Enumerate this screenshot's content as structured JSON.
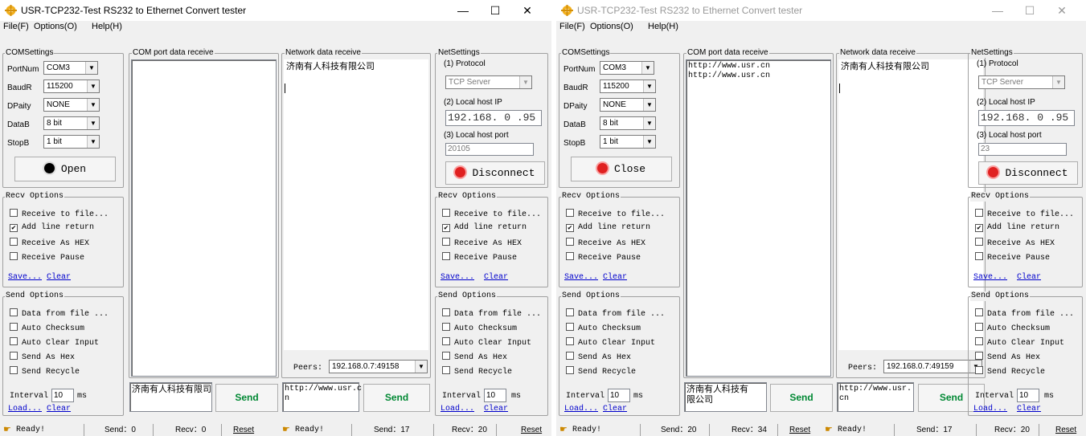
{
  "windows": [
    {
      "title": "USR-TCP232-Test  RS232 to Ethernet Convert tester",
      "controls": {
        "minimize": "—",
        "maximize": "☐",
        "close": "✕"
      },
      "menu": [
        "File(F)",
        "Options(O)",
        "Help(H)"
      ],
      "com": {
        "legend": "COMSettings",
        "fields": [
          {
            "label": "PortNum",
            "value": "COM3"
          },
          {
            "label": "BaudR",
            "value": "115200"
          },
          {
            "label": "DPaity",
            "value": "NONE"
          },
          {
            "label": "DataB",
            "value": "8 bit"
          },
          {
            "label": "StopB",
            "value": "1 bit"
          }
        ],
        "open_button": "Open",
        "indicator_color": "#000000"
      },
      "recv_options": {
        "legend": "Recv Options",
        "items": [
          {
            "label": "Receive to file...",
            "checked": false
          },
          {
            "label": "Add line return",
            "checked": true
          },
          {
            "label": "Receive As HEX",
            "checked": false
          },
          {
            "label": "Receive Pause",
            "checked": false
          }
        ],
        "save": "Save...",
        "clear": "Clear"
      },
      "send_options": {
        "legend": "Send Options",
        "items": [
          {
            "label": "Data from file ...",
            "checked": false
          },
          {
            "label": "Auto Checksum",
            "checked": false
          },
          {
            "label": "Auto Clear Input",
            "checked": false
          },
          {
            "label": "Send As Hex",
            "checked": false
          },
          {
            "label": "Send Recycle",
            "checked": false
          }
        ],
        "interval_label": "Interval",
        "interval_value": "10",
        "interval_unit": "ms",
        "load": "Load...",
        "clear": "Clear"
      },
      "com_receive": {
        "legend": "COM port data receive",
        "text": ""
      },
      "com_send": {
        "text": "济南有人科技有限司",
        "button": "Send"
      },
      "net_receive": {
        "legend": "Network data receive",
        "text": "济南有人科技有限公司"
      },
      "peers": {
        "label": "Peers:",
        "value": "192.168.0.7:49158"
      },
      "net_send": {
        "text": "http://www.usr.c\nn",
        "button": "Send"
      },
      "net": {
        "legend": "NetSettings",
        "protocol_label": "(1) Protocol",
        "protocol_value": "TCP Server",
        "ip_label": "(2) Local host IP",
        "ip_value": "192.168. 0 .95",
        "port_label": "(3) Local host port",
        "port_value": "20105",
        "button": "Disconnect",
        "indicator_color": "#e02020"
      },
      "net_recv_options": {
        "legend": "Recv Options",
        "items": [
          {
            "label": "Receive to file...",
            "checked": false
          },
          {
            "label": "Add line return",
            "checked": true
          },
          {
            "label": "Receive As HEX",
            "checked": false
          },
          {
            "label": "Receive Pause",
            "checked": false
          }
        ],
        "save": "Save...",
        "clear": "Clear"
      },
      "net_send_options": {
        "legend": "Send Options",
        "items": [
          {
            "label": "Data from file ...",
            "checked": false
          },
          {
            "label": "Auto Checksum",
            "checked": false
          },
          {
            "label": "Auto Clear Input",
            "checked": false
          },
          {
            "label": "Send As Hex",
            "checked": false
          },
          {
            "label": "Send Recycle",
            "checked": false
          }
        ],
        "interval_label": "Interval",
        "interval_value": "10",
        "interval_unit": "ms",
        "load": "Load...",
        "clear": "Clear"
      },
      "status_com": {
        "ready": "Ready!",
        "send": "Send：0",
        "recv": "Recv：0",
        "reset": "Reset"
      },
      "status_net": {
        "ready": "Ready!",
        "send": "Send：17",
        "recv": "Recv：20",
        "reset": "Reset"
      }
    },
    {
      "title": "USR-TCP232-Test  RS232 to Ethernet Convert tester",
      "controls": {
        "minimize": "—",
        "maximize": "☐",
        "close": "✕"
      },
      "menu": [
        "File(F)",
        "Options(O)",
        "Help(H)"
      ],
      "com": {
        "legend": "COMSettings",
        "fields": [
          {
            "label": "PortNum",
            "value": "COM3"
          },
          {
            "label": "BaudR",
            "value": "115200"
          },
          {
            "label": "DPaity",
            "value": "NONE"
          },
          {
            "label": "DataB",
            "value": "8 bit"
          },
          {
            "label": "StopB",
            "value": "1 bit"
          }
        ],
        "open_button": "Close",
        "indicator_color": "#e02020"
      },
      "recv_options": {
        "legend": "Recv Options",
        "items": [
          {
            "label": "Receive to file...",
            "checked": false
          },
          {
            "label": "Add line return",
            "checked": true
          },
          {
            "label": "Receive As HEX",
            "checked": false
          },
          {
            "label": "Receive Pause",
            "checked": false
          }
        ],
        "save": "Save...",
        "clear": "Clear"
      },
      "send_options": {
        "legend": "Send Options",
        "items": [
          {
            "label": "Data from file ...",
            "checked": false
          },
          {
            "label": "Auto Checksum",
            "checked": false
          },
          {
            "label": "Auto Clear Input",
            "checked": false
          },
          {
            "label": "Send As Hex",
            "checked": false
          },
          {
            "label": "Send Recycle",
            "checked": false
          }
        ],
        "interval_label": "Interval",
        "interval_value": "10",
        "interval_unit": "ms",
        "load": "Load...",
        "clear": "Clear"
      },
      "com_receive": {
        "legend": "COM port data receive",
        "text": "http://www.usr.cn\nhttp://www.usr.cn"
      },
      "com_send": {
        "text": "济南有人科技有\n限公司",
        "button": "Send"
      },
      "net_receive": {
        "legend": "Network data receive",
        "text": "济南有人科技有限公司"
      },
      "peers": {
        "label": "Peers:",
        "value": "192.168.0.7:49159"
      },
      "net_send": {
        "text": "http://www.usr.\ncn",
        "button": "Send"
      },
      "net": {
        "legend": "NetSettings",
        "protocol_label": "(1) Protocol",
        "protocol_value": "TCP Server",
        "ip_label": "(2) Local host IP",
        "ip_value": "192.168. 0 .95",
        "port_label": "(3) Local host port",
        "port_value": "23",
        "button": "Disconnect",
        "indicator_color": "#e02020"
      },
      "net_recv_options": {
        "legend": "Recv Options",
        "items": [
          {
            "label": "Receive to file...",
            "checked": false
          },
          {
            "label": "Add line return",
            "checked": true
          },
          {
            "label": "Receive As HEX",
            "checked": false
          },
          {
            "label": "Receive Pause",
            "checked": false
          }
        ],
        "save": "Save...",
        "clear": "Clear"
      },
      "net_send_options": {
        "legend": "Send Options",
        "items": [
          {
            "label": "Data from file ...",
            "checked": false
          },
          {
            "label": "Auto Checksum",
            "checked": false
          },
          {
            "label": "Auto Clear Input",
            "checked": false
          },
          {
            "label": "Send As Hex",
            "checked": false
          },
          {
            "label": "Send Recycle",
            "checked": false
          }
        ],
        "interval_label": "Interval",
        "interval_value": "10",
        "interval_unit": "ms",
        "load": "Load...",
        "clear": "Clear"
      },
      "status_com": {
        "ready": "Ready!",
        "send": "Send：20",
        "recv": "Recv：34",
        "reset": "Reset"
      },
      "status_net": {
        "ready": "Ready!",
        "send": "Send：17",
        "recv": "Recv：20",
        "reset": "Reset"
      }
    }
  ]
}
